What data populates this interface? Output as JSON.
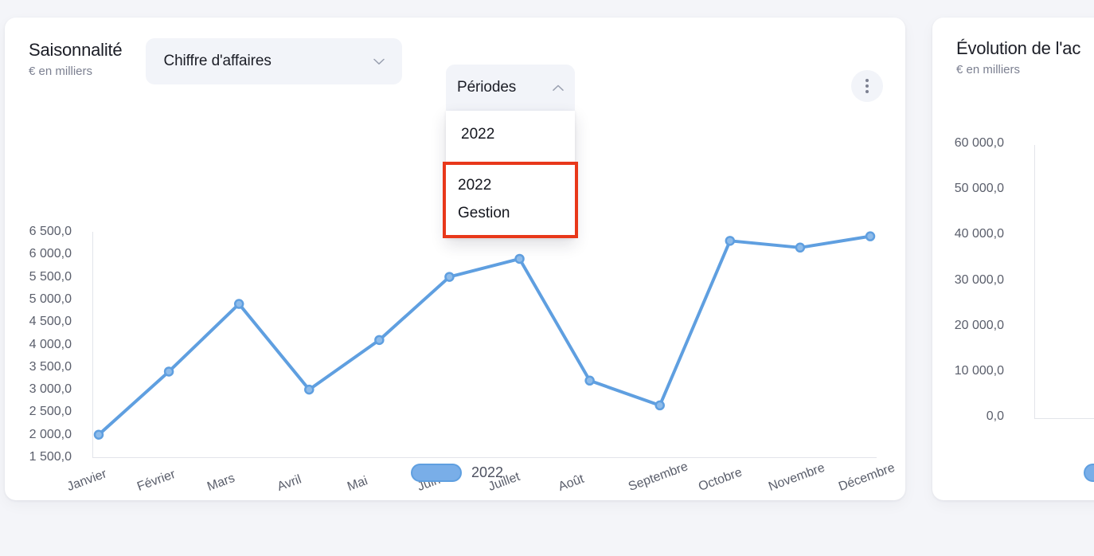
{
  "page": {
    "background_color": "#f4f5f9",
    "accent_color": "#5f9fe0",
    "highlight_color": "#e8381a"
  },
  "main_card": {
    "title": "Saisonnalité",
    "subtitle": "€ en milliers",
    "metric_select": {
      "value": "Chiffre d'affaires",
      "icon": "chevron-down-icon"
    },
    "periods_dropdown": {
      "label": "Périodes",
      "icon": "chevron-up-icon",
      "expanded": true,
      "options": [
        {
          "label": "2022",
          "lines": [
            "2022"
          ],
          "highlighted": false
        },
        {
          "label": "2022 Gestion",
          "lines": [
            "2022",
            "Gestion"
          ],
          "highlighted": true
        }
      ]
    },
    "more_menu": {
      "icon": "kebab-menu-icon"
    },
    "legend": [
      {
        "label": "2022",
        "color": "#79aee8"
      }
    ]
  },
  "side_card": {
    "title": "Évolution de l'ac",
    "subtitle": "€ en milliers",
    "y_ticks": [
      "60 000,0",
      "50 000,0",
      "40 000,0",
      "30 000,0",
      "20 000,0",
      "10 000,0",
      "0,0"
    ]
  },
  "chart_data": {
    "type": "line",
    "title": "Saisonnalité",
    "subtitle": "€ en milliers",
    "xlabel": "",
    "ylabel": "€ en milliers",
    "ylim": [
      1500,
      6500
    ],
    "ytick_step": 500,
    "ytick_labels": [
      "6 500,0",
      "6 000,0",
      "5 500,0",
      "5 000,0",
      "4 500,0",
      "4 000,0",
      "3 500,0",
      "3 000,0",
      "2 500,0",
      "2 000,0",
      "1 500,0"
    ],
    "grid": false,
    "legend_position": "bottom",
    "categories": [
      "Janvier",
      "Février",
      "Mars",
      "Avril",
      "Mai",
      "Juin",
      "Juillet",
      "Août",
      "Septembre",
      "Octobre",
      "Novembre",
      "Décembre"
    ],
    "series": [
      {
        "name": "2022",
        "color": "#5f9fe0",
        "values": [
          2000,
          3400,
          4900,
          3000,
          4100,
          5500,
          5900,
          3200,
          2650,
          6300,
          6150,
          6400
        ]
      }
    ]
  },
  "side_chart_data": {
    "type": "line",
    "title": "Évolution de l'ac",
    "subtitle": "€ en milliers",
    "ylim": [
      0,
      60000
    ],
    "ytick_step": 10000,
    "ytick_labels": [
      "60 000,0",
      "50 000,0",
      "40 000,0",
      "30 000,0",
      "20 000,0",
      "10 000,0",
      "0,0"
    ],
    "legend_position": "bottom",
    "series": [
      {
        "name": "",
        "color": "#79aee8",
        "values": []
      }
    ]
  }
}
